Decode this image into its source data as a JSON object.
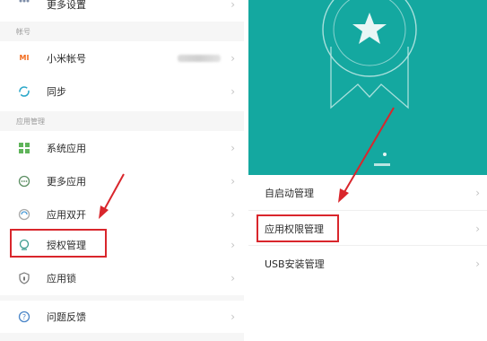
{
  "left_panel": {
    "more_settings": "更多设置",
    "section_account": "帐号",
    "mi_account": "小米帐号",
    "mi_logo": "MI",
    "sync": "同步",
    "section_apps": "应用管理",
    "system_apps": "系统应用",
    "more_apps": "更多应用",
    "dual_apps": "应用双开",
    "permissions": "授权管理",
    "app_lock": "应用锁",
    "feedback": "问题反馈"
  },
  "right_panel": {
    "autostart": "自启动管理",
    "app_permissions": "应用权限管理",
    "usb_install": "USB安装管理"
  },
  "colors": {
    "hero": "#14a8a0",
    "highlight": "#d9262c",
    "arrow": "#d9262c",
    "chevron": "#c4c4c4"
  },
  "icons": [
    "grid-icon",
    "mi-logo",
    "sync-icon",
    "system-apps-icon",
    "more-apps-icon",
    "dual-apps-icon",
    "shield-user-icon",
    "lock-icon",
    "help-icon",
    "star-badge-icon",
    "chevron-right-icon"
  ]
}
